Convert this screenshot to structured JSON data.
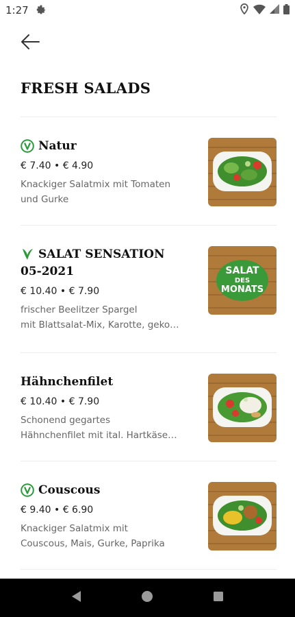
{
  "status_bar": {
    "time": "1:27"
  },
  "page": {
    "title": "FRESH SALADS"
  },
  "items": [
    {
      "name": "Natur",
      "price": "€ 7.40 • € 4.90",
      "desc1": "Knackiger Salatmix mit Tomaten",
      "desc2": "und Gurke",
      "badge": "vegan-circle-icon",
      "image": "green-salad-bowl"
    },
    {
      "name": "SALAT SENSATION",
      "name2": "05-2021",
      "price": "€ 10.40 • € 7.90",
      "desc1": "frischer Beelitzer Spargel",
      "desc2": "mit Blattsalat-Mix, Karotte, geko…",
      "badge": "vegetarian-leaf-icon",
      "image": "salat-des-monats-logo",
      "image_text": [
        "SALAT",
        "DES",
        "MONATS"
      ]
    },
    {
      "name": "Hähnchenfilet",
      "price": "€ 10.40 • € 7.90",
      "desc1": "Schonend gegartes",
      "desc2": "Hähnchenfilet mit ital. Hartkäse…",
      "image": "chicken-salad-bowl"
    },
    {
      "name": "Couscous",
      "price": "€ 9.40 • € 6.90",
      "desc1": "Knackiger Salatmix mit",
      "desc2": "Couscous, Mais, Gurke, Paprika",
      "badge": "vegan-circle-icon",
      "image": "couscous-salad-bowl"
    }
  ],
  "colors": {
    "accent_green": "#2a9a3a",
    "wood": "#b07a3a",
    "text": "#1a1a1a",
    "muted": "#666666"
  }
}
